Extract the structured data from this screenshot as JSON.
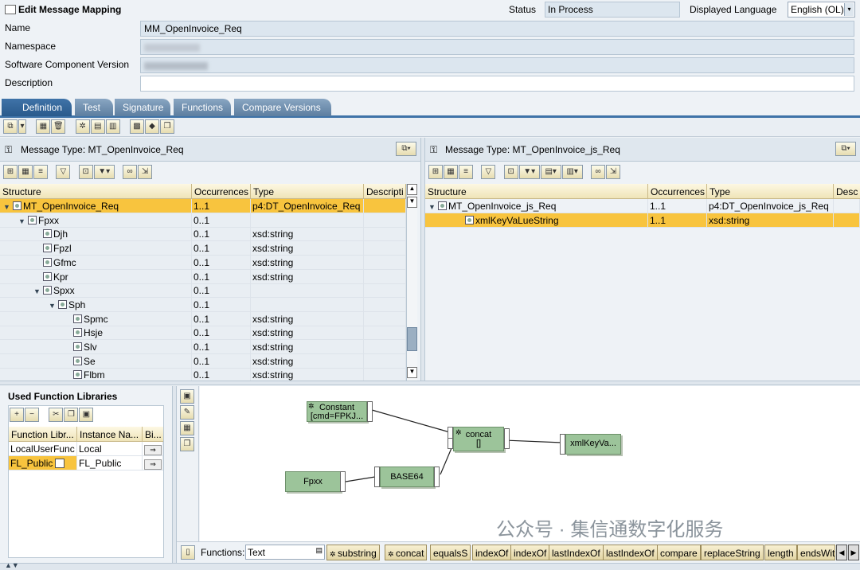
{
  "title": "Edit Message Mapping",
  "status_label": "Status",
  "status_value": "In Process",
  "lang_label": "Displayed Language",
  "lang_value": "English (OL)",
  "fields": {
    "name_label": "Name",
    "name_value": "MM_OpenInvoice_Req",
    "namespace_label": "Namespace",
    "namespace_value": "",
    "scv_label": "Software Component Version",
    "scv_value": "",
    "desc_label": "Description",
    "desc_value": ""
  },
  "tabs": [
    "Definition",
    "Test",
    "Signature",
    "Functions",
    "Compare Versions"
  ],
  "source": {
    "title": "Message Type: MT_OpenInvoice_Req",
    "columns": [
      "Structure",
      "Occurrences",
      "Type",
      "Descripti"
    ],
    "rows": [
      {
        "name": "MT_OpenInvoice_Req",
        "occ": "1..1",
        "type": "p4:DT_OpenInvoice_Req"
      },
      {
        "name": "Fpxx",
        "occ": "0..1",
        "type": ""
      },
      {
        "name": "Djh",
        "occ": "0..1",
        "type": "xsd:string"
      },
      {
        "name": "Fpzl",
        "occ": "0..1",
        "type": "xsd:string"
      },
      {
        "name": "Gfmc",
        "occ": "0..1",
        "type": "xsd:string"
      },
      {
        "name": "Kpr",
        "occ": "0..1",
        "type": "xsd:string"
      },
      {
        "name": "Spxx",
        "occ": "0..1",
        "type": ""
      },
      {
        "name": "Sph",
        "occ": "0..1",
        "type": ""
      },
      {
        "name": "Spmc",
        "occ": "0..1",
        "type": "xsd:string"
      },
      {
        "name": "Hsje",
        "occ": "0..1",
        "type": "xsd:string"
      },
      {
        "name": "Slv",
        "occ": "0..1",
        "type": "xsd:string"
      },
      {
        "name": "Se",
        "occ": "0..1",
        "type": "xsd:string"
      },
      {
        "name": "Flbm",
        "occ": "0..1",
        "type": "xsd:string"
      }
    ]
  },
  "target": {
    "title": "Message Type: MT_OpenInvoice_js_Req",
    "columns": [
      "Structure",
      "Occurrences",
      "Type",
      "Desc"
    ],
    "rows": [
      {
        "name": "MT_OpenInvoice_js_Req",
        "occ": "1..1",
        "type": "p4:DT_OpenInvoice_js_Req"
      },
      {
        "name": "xmlKeyVaLueString",
        "occ": "1..1",
        "type": "xsd:string"
      }
    ]
  },
  "libraries": {
    "title": "Used Function Libraries",
    "columns": [
      "Function Libr...",
      "Instance Na...",
      "Bi..."
    ],
    "rows": [
      {
        "lib": "LocalUserFunc",
        "inst": "Local"
      },
      {
        "lib": "FL_Public",
        "inst": "FL_Public"
      }
    ]
  },
  "graph": {
    "constant_label": "Constant",
    "constant_sub": "[cmd=FPKJ...",
    "concat_label": "concat",
    "concat_sub": "[]",
    "target_label": "xmlKeyVa...",
    "fpxx_label": "Fpxx",
    "base64_label": "BASE64"
  },
  "functions": {
    "label": "Functions:",
    "category": "Text",
    "items": [
      "substring",
      "concat",
      "equalsS",
      "indexOf",
      "indexOf",
      "lastIndexOf",
      "lastIndexOf",
      "compare",
      "replaceString",
      "length",
      "endsWit"
    ]
  },
  "watermark": "公众号 · 集信通数字化服务"
}
